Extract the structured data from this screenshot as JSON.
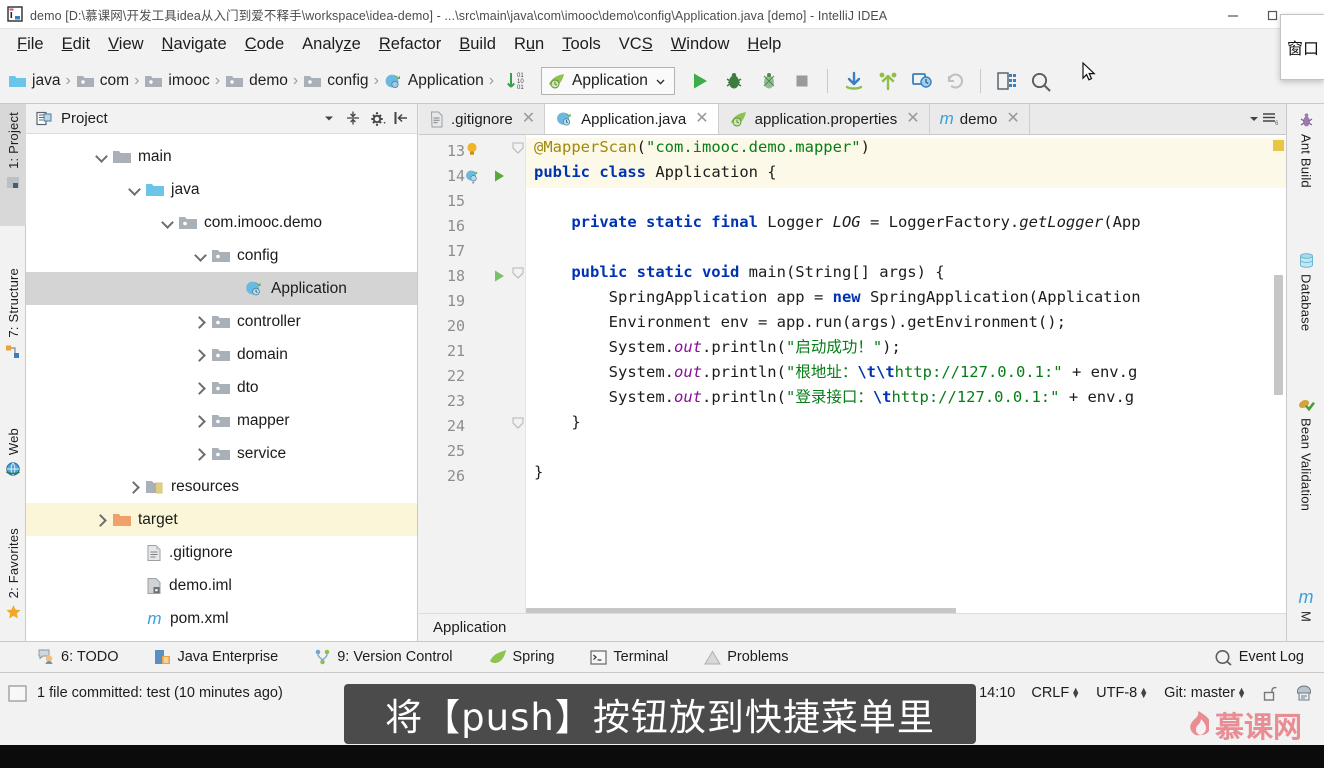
{
  "window": {
    "title": "demo [D:\\慕课网\\开发工具idea从入门到爱不释手\\workspace\\idea-demo] - ...\\src\\main\\java\\com\\imooc\\demo\\config\\Application.java [demo] - IntelliJ IDEA",
    "app_icon": "intellij-idea-icon",
    "minimize_label": "—",
    "restore_label": "❐",
    "close_label": "✕"
  },
  "menubar": {
    "items": [
      {
        "label": "File",
        "mnemonic": "F"
      },
      {
        "label": "Edit",
        "mnemonic": "E"
      },
      {
        "label": "View",
        "mnemonic": "V"
      },
      {
        "label": "Navigate",
        "mnemonic": "N"
      },
      {
        "label": "Code",
        "mnemonic": "C"
      },
      {
        "label": "Analyze",
        "mnemonic": "z"
      },
      {
        "label": "Refactor",
        "mnemonic": "R"
      },
      {
        "label": "Build",
        "mnemonic": "B"
      },
      {
        "label": "Run",
        "mnemonic": "u"
      },
      {
        "label": "Tools",
        "mnemonic": "T"
      },
      {
        "label": "VCS",
        "mnemonic": "S"
      },
      {
        "label": "Window",
        "mnemonic": "W"
      },
      {
        "label": "Help",
        "mnemonic": "H"
      }
    ]
  },
  "navbar": {
    "crumbs": [
      {
        "label": "java",
        "icon": "source-folder-icon"
      },
      {
        "label": "com",
        "icon": "package-icon"
      },
      {
        "label": "imooc",
        "icon": "package-icon"
      },
      {
        "label": "demo",
        "icon": "package-icon"
      },
      {
        "label": "config",
        "icon": "package-icon"
      },
      {
        "label": "Application",
        "icon": "spring-class-icon"
      }
    ],
    "separator": "›",
    "sort_icon": "sort-numeric-icon",
    "run_config": {
      "label": "Application",
      "icon": "spring-boot-icon",
      "chevron": "⌄"
    },
    "buttons": [
      {
        "name": "run-button",
        "icon": "run-icon",
        "color": "#3dac4b"
      },
      {
        "name": "debug-button",
        "icon": "debug-bug-icon",
        "color": "#3b7d3b"
      },
      {
        "name": "run-with-coverage-button",
        "icon": "coverage-icon",
        "color": "#4b8c4b"
      },
      {
        "name": "stop-button",
        "icon": "stop-icon",
        "color": "#9a9a9a"
      },
      {
        "name": "vcs-update-button",
        "icon": "update-project-icon",
        "color": "#3a7fbf"
      },
      {
        "name": "vcs-commit-button",
        "icon": "commit-icon",
        "color": "#5a9e3a"
      },
      {
        "name": "vcs-history-button",
        "icon": "history-icon",
        "color": "#3a7fbf"
      },
      {
        "name": "vcs-rollback-button",
        "icon": "rollback-icon",
        "color": "#b8b8b8"
      },
      {
        "name": "structure-button",
        "icon": "project-structure-icon",
        "color": "#3a7fbf"
      },
      {
        "name": "search-everywhere-button",
        "icon": "search-icon",
        "color": "#6e6e6e"
      }
    ]
  },
  "left_strip": {
    "items": [
      {
        "label": "1: Project",
        "mnemonic": "1",
        "icon": "project-icon",
        "active": true
      },
      {
        "label": "7: Structure",
        "mnemonic": "7",
        "icon": "structure-icon",
        "active": false
      },
      {
        "label": "Web",
        "mnemonic": "",
        "icon": "web-icon",
        "active": false
      },
      {
        "label": "2: Favorites",
        "mnemonic": "2",
        "icon": "favorites-star-icon",
        "active": false
      }
    ]
  },
  "right_strip": {
    "items": [
      {
        "label": "Ant Build",
        "icon": "ant-icon"
      },
      {
        "label": "Database",
        "icon": "database-icon"
      },
      {
        "label": "Bean Validation",
        "icon": "bean-validation-icon"
      },
      {
        "label": "M",
        "icon": "maven-icon"
      }
    ]
  },
  "project_panel": {
    "title": "Project",
    "title_icon": "project-panel-icon",
    "header_buttons": [
      {
        "name": "view-mode-chevron",
        "icon": "chevron-down-icon"
      },
      {
        "name": "expand-collapse-button",
        "icon": "collapse-all-icon"
      },
      {
        "name": "settings-gear-button",
        "icon": "gear-icon"
      },
      {
        "name": "hide-panel-button",
        "icon": "hide-panel-icon"
      }
    ],
    "tree": [
      {
        "label": "main",
        "indent": 2,
        "arrow": "down",
        "icon": "folder-gray-icon",
        "state": "normal"
      },
      {
        "label": "java",
        "indent": 3,
        "arrow": "down",
        "icon": "folder-source-icon",
        "state": "normal"
      },
      {
        "label": "com.imooc.demo",
        "indent": 4,
        "arrow": "down",
        "icon": "package-icon",
        "state": "normal"
      },
      {
        "label": "config",
        "indent": 5,
        "arrow": "down",
        "icon": "package-icon",
        "state": "normal"
      },
      {
        "label": "Application",
        "indent": 6,
        "arrow": "none",
        "icon": "spring-class-icon",
        "state": "selected"
      },
      {
        "label": "controller",
        "indent": 5,
        "arrow": "right",
        "icon": "package-icon",
        "state": "normal"
      },
      {
        "label": "domain",
        "indent": 5,
        "arrow": "right",
        "icon": "package-icon",
        "state": "normal"
      },
      {
        "label": "dto",
        "indent": 5,
        "arrow": "right",
        "icon": "package-icon",
        "state": "normal"
      },
      {
        "label": "mapper",
        "indent": 5,
        "arrow": "right",
        "icon": "package-icon",
        "state": "normal"
      },
      {
        "label": "service",
        "indent": 5,
        "arrow": "right",
        "icon": "package-icon",
        "state": "normal"
      },
      {
        "label": "resources",
        "indent": 3,
        "arrow": "right",
        "icon": "resources-folder-icon",
        "state": "normal"
      },
      {
        "label": "target",
        "indent": 1,
        "arrow": "right",
        "icon": "folder-orange-icon",
        "state": "highlight"
      },
      {
        "label": ".gitignore",
        "indent": 2,
        "arrow": "none",
        "icon": "text-file-icon",
        "state": "normal"
      },
      {
        "label": "demo.iml",
        "indent": 2,
        "arrow": "none",
        "icon": "iml-file-icon",
        "state": "normal"
      },
      {
        "label": "pom.xml",
        "indent": 2,
        "arrow": "none",
        "icon": "maven-pom-icon",
        "state": "normal"
      }
    ]
  },
  "editor": {
    "tabs": [
      {
        "label": ".gitignore",
        "icon": "text-file-icon",
        "active": false,
        "close": "✕"
      },
      {
        "label": "Application.java",
        "icon": "spring-class-icon",
        "active": true,
        "close": "✕"
      },
      {
        "label": "application.properties",
        "icon": "spring-leaf-icon",
        "active": false,
        "close": "✕"
      },
      {
        "label": "demo",
        "icon": "maven-pom-icon",
        "active": false,
        "close": "✕"
      }
    ],
    "tabs_menu_icon": "tab-list-menu-icon",
    "first_line_number": 13,
    "lines": [
      {
        "num": 13,
        "text": "@MapperScan(\"com.imooc.demo.mapper\")",
        "gutter": "fold-end",
        "highlighted": true
      },
      {
        "num": 14,
        "text": "public class Application {",
        "gutter": "spring-run",
        "highlighted": true
      },
      {
        "num": 15,
        "text": "",
        "gutter": "",
        "highlighted": false
      },
      {
        "num": 16,
        "text": "    private static final Logger LOG = LoggerFactory.getLogger(App",
        "gutter": "",
        "highlighted": false
      },
      {
        "num": 17,
        "text": "",
        "gutter": "",
        "highlighted": false
      },
      {
        "num": 18,
        "text": "    public static void main(String[] args) {",
        "gutter": "run",
        "highlighted": false
      },
      {
        "num": 19,
        "text": "        SpringApplication app = new SpringApplication(Application",
        "gutter": "",
        "highlighted": false
      },
      {
        "num": 20,
        "text": "        Environment env = app.run(args).getEnvironment();",
        "gutter": "",
        "highlighted": false
      },
      {
        "num": 21,
        "text": "        System.out.println(\"启动成功！\");",
        "gutter": "",
        "highlighted": false
      },
      {
        "num": 22,
        "text": "        System.out.println(\"根地址：\\t\\thttp://127.0.0.1:\" + env.g",
        "gutter": "",
        "highlighted": false
      },
      {
        "num": 23,
        "text": "        System.out.println(\"登录接口：\\thttp://127.0.0.1:\" + env.g",
        "gutter": "",
        "highlighted": false
      },
      {
        "num": 24,
        "text": "    }",
        "gutter": "fold-end",
        "highlighted": false
      },
      {
        "num": 25,
        "text": "",
        "gutter": "",
        "highlighted": false
      },
      {
        "num": 26,
        "text": "}",
        "gutter": "",
        "highlighted": false
      }
    ],
    "breadcrumb": "Application",
    "warning_stripe_color": "#e8c545"
  },
  "bottom_bar": {
    "items": [
      {
        "label": "6: TODO",
        "mnemonic": "6",
        "icon": "todo-icon"
      },
      {
        "label": "Java Enterprise",
        "mnemonic": "",
        "icon": "java-enterprise-icon"
      },
      {
        "label": "9: Version Control",
        "mnemonic": "9",
        "icon": "version-control-icon"
      },
      {
        "label": "Spring",
        "mnemonic": "",
        "icon": "spring-leaf-icon"
      },
      {
        "label": "Terminal",
        "mnemonic": "",
        "icon": "terminal-icon"
      },
      {
        "label": "Problems",
        "mnemonic": "",
        "icon": "problems-warning-icon"
      }
    ],
    "event_log": {
      "label": "Event Log",
      "icon": "event-log-icon"
    }
  },
  "status_bar": {
    "message": "1 file committed: test (10 minutes ago)",
    "caret_position": "14:10",
    "line_separator": "CRLF",
    "encoding": "UTF-8",
    "branch": "Git: master",
    "lock_icon": "unlocked-icon",
    "inspection_icon": "inspection-hector-icon",
    "toggle_icon": "toggle-memory-icon"
  },
  "overlays": {
    "tooltip_text": "窗口",
    "subtitle": "将【push】按钮放到快捷菜单里",
    "watermark": "慕课网",
    "watermark_icon": "flame-icon",
    "watermark_color": "#e8858c"
  }
}
